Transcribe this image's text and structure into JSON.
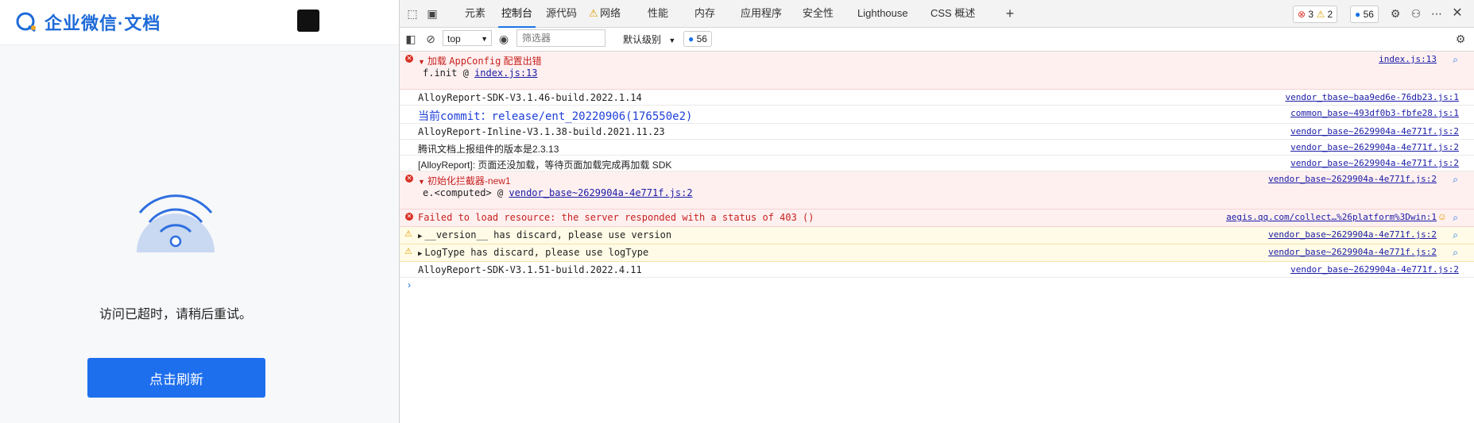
{
  "app": {
    "logo_text": "企业微信·文档",
    "timeout_message": "访问已超时，请稍后重试。",
    "refresh_button": "点击刷新"
  },
  "devtools": {
    "tabs": [
      "元素",
      "控制台",
      "源代码",
      "网络",
      "性能",
      "内存",
      "应用程序",
      "安全性",
      "Lighthouse",
      "CSS 概述"
    ],
    "active_tab": "控制台",
    "error_count": "3",
    "warning_count": "2",
    "message_count": "56",
    "context": "top",
    "filter_placeholder": "筛选器",
    "level": "默认级别",
    "toolbar_message_count": "56"
  },
  "console": {
    "row1": {
      "prefix": "加载",
      "code": "AppConfig",
      "suffix": "配置出错",
      "source": "index.js:13",
      "sub_prefix": "f.init @",
      "sub_link": "index.js:13"
    },
    "row2": {
      "text": "AlloyReport-SDK-V3.1.46-build.2022.1.14",
      "source": "vendor_tbase~baa9ed6e-76db23.js:1"
    },
    "row3": {
      "text": "当前commit：release/ent_20220906(176550e2)",
      "source": "common_base~493df0b3-fbfe28.js:1"
    },
    "row4": {
      "text": "AlloyReport-Inline-V3.1.38-build.2021.11.23",
      "source": "vendor_base~2629904a-4e771f.js:2"
    },
    "row5": {
      "text": "腾讯文档上报组件的版本是2.3.13",
      "source": "vendor_base~2629904a-4e771f.js:2"
    },
    "row6": {
      "text": "[AlloyReport]: 页面还没加载，等待页面加载完成再加载 SDK",
      "source": "vendor_base~2629904a-4e771f.js:2"
    },
    "row7": {
      "text": "初始化拦截器-new1",
      "source": "vendor_base~2629904a-4e771f.js:2",
      "sub_prefix": "e.<computed> @",
      "sub_link": "vendor_base~2629904a-4e771f.js:2"
    },
    "row8": {
      "text": "Failed to load resource: the server responded with a status of 403 ()",
      "source": "aegis.qq.com/collect…%26platform%3Dwin:1"
    },
    "row9": {
      "text": "__version__ has discard, please use version",
      "source": "vendor_base~2629904a-4e771f.js:2"
    },
    "row10": {
      "text": "LogType has discard, please use logType",
      "source": "vendor_base~2629904a-4e771f.js:2"
    },
    "row11": {
      "text": "AlloyReport-SDK-V3.1.51-build.2022.4.11",
      "source": "vendor_base~2629904a-4e771f.js:2"
    }
  }
}
